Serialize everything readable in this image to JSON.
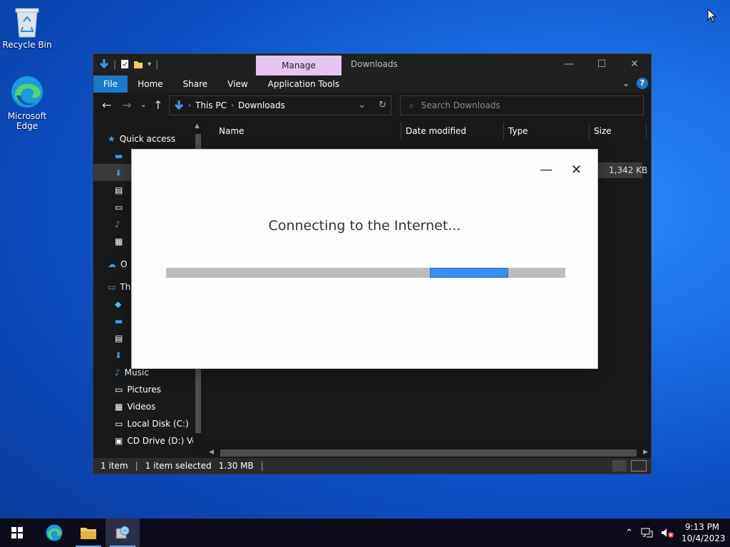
{
  "desktop": {
    "icons": [
      {
        "label": "Recycle Bin"
      },
      {
        "label": "Microsoft Edge"
      }
    ]
  },
  "explorer": {
    "ribbon_context_tab": "Manage",
    "window_title": "Downloads",
    "ribbon_tabs": [
      "File",
      "Home",
      "Share",
      "View",
      "Application Tools"
    ],
    "breadcrumb": [
      "This PC",
      "Downloads"
    ],
    "search_placeholder": "Search Downloads",
    "columns": [
      "Name",
      "Date modified",
      "Type",
      "Size"
    ],
    "row_size": "1,342 KB",
    "nav": {
      "quick_access": "Quick access",
      "onedrive": "O",
      "this_pc": "Th",
      "music": "Music",
      "pictures": "Pictures",
      "videos": "Videos",
      "local_disk": "Local Disk (C:)",
      "cd_drive": "CD Drive (D:) Ver"
    },
    "status": {
      "count": "1 item",
      "selected": "1 item selected",
      "size": "1.30 MB"
    }
  },
  "dialog": {
    "message": "Connecting to the Internet...",
    "progress": {
      "start": 0.661,
      "end": 0.857
    }
  },
  "taskbar": {
    "time": "9:13 PM",
    "date": "10/4/2023"
  }
}
